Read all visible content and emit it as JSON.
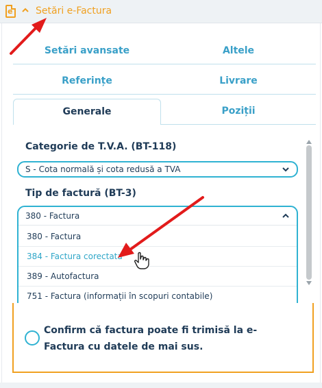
{
  "header": {
    "icon_letter": "e",
    "title": "Setări e-Factura"
  },
  "tabs": {
    "row1": [
      "Setări avansate",
      "Altele"
    ],
    "row2": [
      "Referințe",
      "Livrare"
    ],
    "row3": [
      "Generale",
      "Poziții"
    ],
    "active": "Generale"
  },
  "vat": {
    "label": "Categorie de T.V.A. (BT-118)",
    "value": "S - Cota normală și cota redusă a TVA"
  },
  "invoice_type": {
    "label": "Tip de factură (BT-3)",
    "value": "380 - Factura",
    "options": [
      "380 - Factura",
      "384 - Factura corectata",
      "389 - Autofactura",
      "751 - Factura (informații în scopuri contabile)"
    ],
    "hovered_option": "384 - Factura corectata"
  },
  "confirm": {
    "text": "Confirm că factura poate fi trimisă la e-Factura cu datele de mai sus."
  },
  "colors": {
    "accent": "#f0a020",
    "tab_text": "#3aa0c8",
    "border": "#2fb2d2",
    "text": "#1f3b57",
    "arrow": "#e21b1b"
  },
  "icons": [
    "document-e-icon",
    "chevron-up-icon",
    "chevron-down-icon",
    "hand-cursor-icon",
    "annotation-arrow-icon"
  ]
}
